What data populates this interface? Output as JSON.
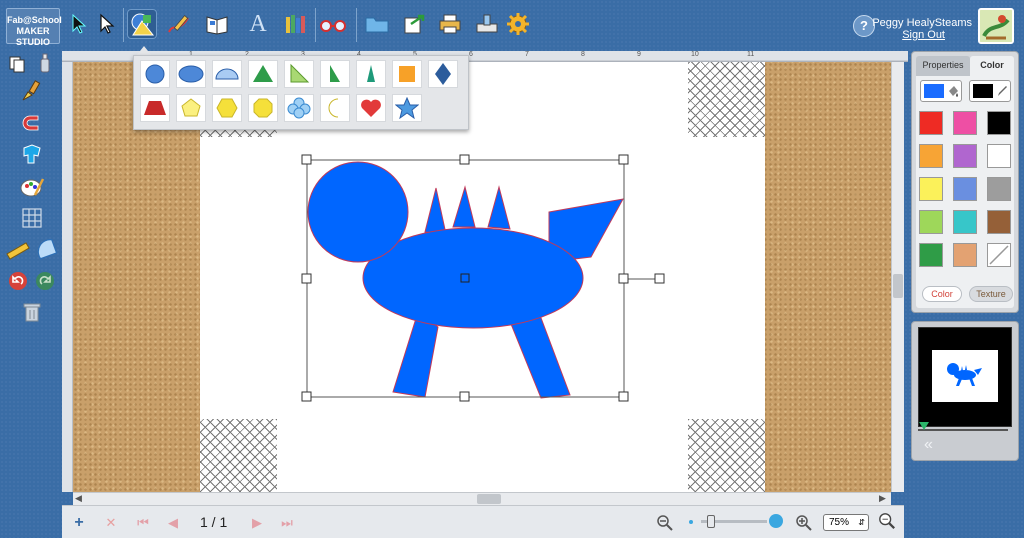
{
  "app": {
    "logo_line1": "Fab@School",
    "logo_line2": "MAKER STUDIO"
  },
  "toolbar": {
    "tools": [
      {
        "name": "select-arrow-icon"
      },
      {
        "name": "direct-select-arrow-icon"
      },
      {
        "name": "shapes-icon",
        "active": true
      },
      {
        "name": "pencil-icon"
      },
      {
        "name": "book-icon"
      },
      {
        "name": "text-icon",
        "glyph": "A"
      },
      {
        "name": "library-icon"
      },
      {
        "name": "glasses-icon"
      },
      {
        "name": "folder-icon"
      },
      {
        "name": "export-icon"
      },
      {
        "name": "print-icon"
      },
      {
        "name": "cutter-icon"
      },
      {
        "name": "gear-icon"
      }
    ]
  },
  "user": {
    "name": "Peggy HealySteams",
    "signout": "Sign Out",
    "help": "?"
  },
  "ruler": {
    "numbers": [
      "1",
      "2",
      "3",
      "4",
      "5",
      "6",
      "7",
      "8",
      "9",
      "10",
      "11"
    ]
  },
  "shape_popup": {
    "row1": [
      "circle",
      "ellipse",
      "half-circle",
      "triangle",
      "right-triangle",
      "tall-triangle",
      "narrow-triangle",
      "square",
      "diamond"
    ],
    "row2": [
      "trapezoid",
      "pentagon",
      "hexagon",
      "octagon",
      "cloud",
      "crescent",
      "heart",
      "star"
    ]
  },
  "canvas": {
    "shape_color": "#0066ff",
    "outline_color": "#c0395a"
  },
  "bottombar": {
    "page_indicator": "1 / 1",
    "zoom_level": "75%",
    "zoom_slider_value": 1.0
  },
  "right_panel": {
    "tabs": [
      "Properties",
      "Color"
    ],
    "active_tab": "Color",
    "fill_color": "#1a6cff",
    "stroke_color": "#000000",
    "swatches": [
      "#ee2b24",
      "#ee4fa4",
      "#000000",
      "#f7a435",
      "#b066cf",
      "#ffffff",
      "#fbf15a",
      "#6a8fe0",
      "#9d9d9d",
      "#9ed75a",
      "#37c6c9",
      "#956038",
      "#2f9c47",
      "#e3a272",
      "transparent"
    ],
    "buttons": [
      "Color",
      "Texture"
    ]
  },
  "thumbnail": {
    "collapse": "«"
  }
}
